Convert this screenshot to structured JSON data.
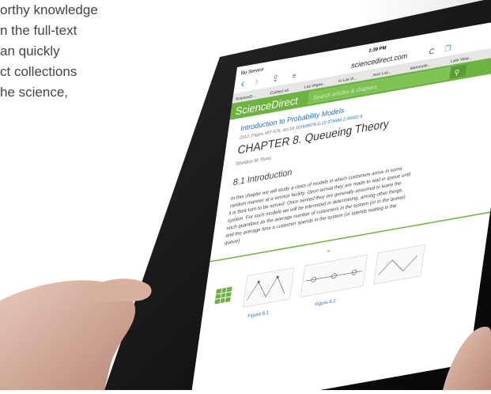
{
  "background_text": {
    "lines": [
      "orthy knowledge",
      "n the full-text",
      "an quickly",
      "ct collections",
      "he science,"
    ]
  },
  "status_bar": {
    "carrier": "No Service",
    "time": "1:39 PM"
  },
  "browser": {
    "url": "sciencedirect.com",
    "tabs": [
      "ScienceD...",
      "Contact us",
      "Las Vegas...",
      "In Las Vi...",
      "near Las...",
      "Mammoth...",
      "Lake View..."
    ]
  },
  "site": {
    "logo": "ScienceDirect",
    "search_placeholder": "Search articles & chapters"
  },
  "article": {
    "book_title": "Introduction to Probability Models",
    "meta_prefix": "2010, Pages 497-578, doi:",
    "doi": "10.1016/B978-0-12-375686-2.00002-9",
    "chapter_title": "CHAPTER 8. Queueing Theory",
    "author": "Sheldon M. Ross",
    "section_heading": "8.1 Introduction",
    "body_lines": [
      "In this chapter we will study a class of models in which customers arrive in some",
      "random manner at a service facility. Upon arrival they are made to wait in queue until",
      "it is their turn to be served. Once served they are generally assumed to leave the",
      "system. For such models we will be interested in determining, among other things,",
      "such quantities as the average number of customers in the system (or in the queue)",
      "and the average time a customer spends in the system (or spends waiting in the",
      "queue)."
    ],
    "figures": [
      "Figure 8.1",
      "Figure 8.2"
    ]
  },
  "colors": {
    "brand_green": "#6db33f",
    "link_blue": "#1f6fbf",
    "tablet_frame": "#111111"
  }
}
